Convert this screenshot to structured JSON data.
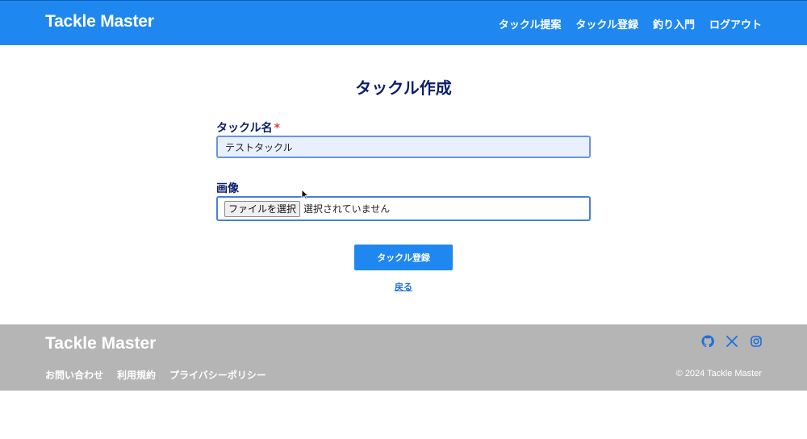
{
  "header": {
    "brand": "Tackle Master",
    "nav": [
      "タックル提案",
      "タックル登録",
      "釣り入門",
      "ログアウト"
    ]
  },
  "page": {
    "title": "タックル作成"
  },
  "form": {
    "name_label": "タックル名",
    "required_mark": "*",
    "name_value": "テストタックル",
    "image_label": "画像",
    "file_button": "ファイルを選択",
    "file_status": "選択されていません",
    "submit": "タックル登録",
    "back": "戻る"
  },
  "footer": {
    "brand": "Tackle Master",
    "links": [
      "お問い合わせ",
      "利用規約",
      "プライバシーポリシー"
    ],
    "social_icons": [
      "github-icon",
      "x-icon",
      "instagram-icon"
    ],
    "copyright": "© 2024 Tackle Master"
  },
  "colors": {
    "primary": "#1e88f0",
    "title": "#0b1f6b",
    "footer_bg": "#b5b5b5",
    "required": "#e53e3e"
  }
}
